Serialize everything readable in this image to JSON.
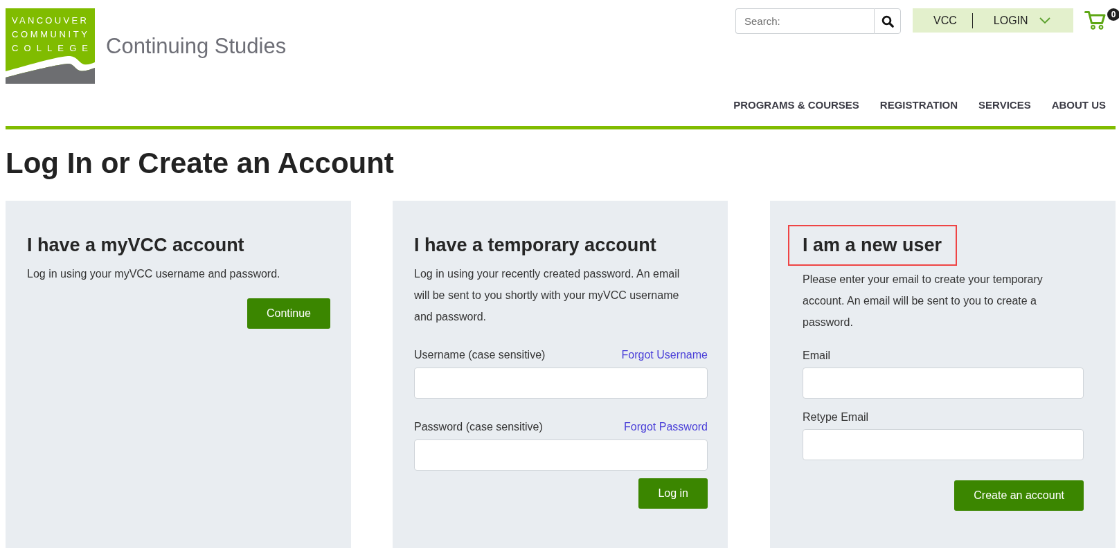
{
  "header": {
    "logo": {
      "lines": [
        "VANCOUVER",
        "COMMUNITY",
        "COLLEGE"
      ]
    },
    "site_name": "Continuing Studies",
    "search": {
      "placeholder": "Search:"
    },
    "account_menu": [
      {
        "label": "VCC",
        "kind": "link"
      },
      {
        "label": "LOGIN",
        "kind": "dropdown"
      }
    ],
    "cart": {
      "count": "0"
    }
  },
  "nav": [
    "PROGRAMS & COURSES",
    "REGISTRATION",
    "SERVICES",
    "ABOUT US"
  ],
  "page_title": "Log In or Create an Account",
  "cards": [
    {
      "heading": "I have a myVCC account",
      "highlighted": false,
      "description": "Log in using your myVCC username and password.",
      "button": "Continue"
    },
    {
      "heading": "I have a temporary account",
      "highlighted": false,
      "description": "Log in using your recently created password. An email will be sent to you shortly with your myVCC username and password.",
      "fields": [
        {
          "label": "Username (case sensitive)",
          "link": "Forgot Username"
        },
        {
          "label": "Password (case sensitive)",
          "link": "Forgot Password"
        }
      ],
      "button": "Log in"
    },
    {
      "heading": "I am a new user",
      "highlighted": true,
      "description": "Please enter your email to create your temporary account. An email will be sent to you to create a password.",
      "fields": [
        {
          "label": "Email"
        },
        {
          "label": "Retype Email"
        }
      ],
      "button": "Create an account"
    }
  ]
}
